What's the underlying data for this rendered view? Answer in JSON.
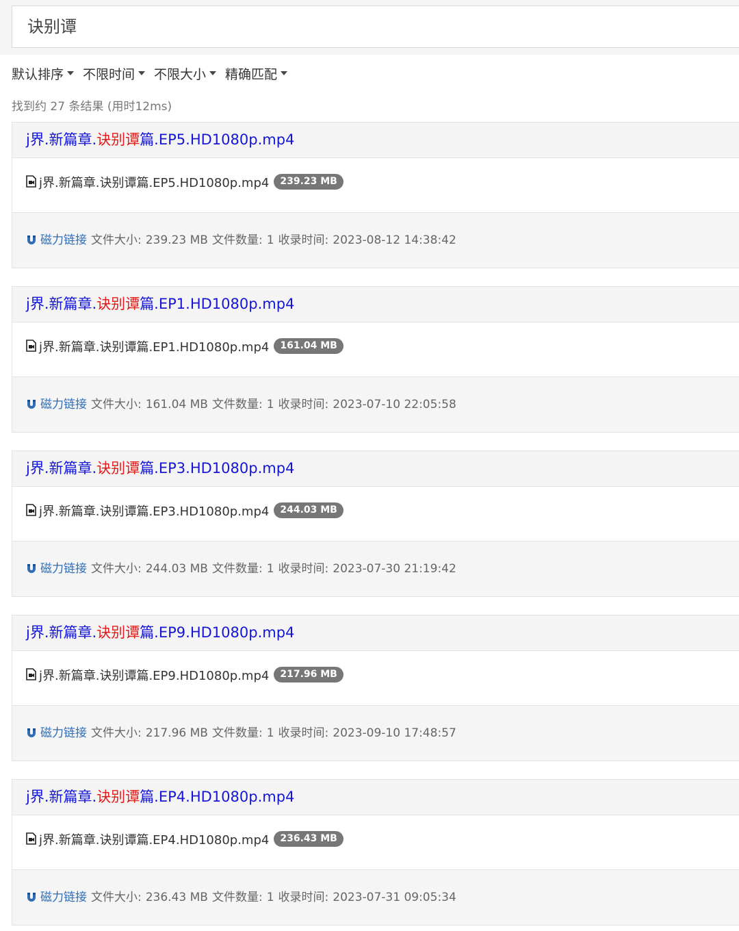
{
  "search": {
    "value": "诀别谭"
  },
  "filters": [
    {
      "label": "默认排序"
    },
    {
      "label": "不限时间"
    },
    {
      "label": "不限大小"
    },
    {
      "label": "精确匹配"
    }
  ],
  "summary": "找到约 27 条结果 (用时12ms)",
  "labels": {
    "magnet": "磁力链接",
    "size_prefix": "文件大小:",
    "count_prefix": "文件数量:",
    "time_prefix": "收录时间:"
  },
  "results": [
    {
      "title_pre": "j界.新篇章.",
      "title_hl": "诀别谭",
      "title_post": "篇.EP5.HD1080p.mp4",
      "file": "j界.新篇章.诀别谭篇.EP5.HD1080p.mp4",
      "size": "239.23 MB",
      "count": "1",
      "time": "2023-08-12 14:38:42"
    },
    {
      "title_pre": "j界.新篇章.",
      "title_hl": "诀别谭",
      "title_post": "篇.EP1.HD1080p.mp4",
      "file": "j界.新篇章.诀别谭篇.EP1.HD1080p.mp4",
      "size": "161.04 MB",
      "count": "1",
      "time": "2023-07-10 22:05:58"
    },
    {
      "title_pre": "j界.新篇章.",
      "title_hl": "诀别谭",
      "title_post": "篇.EP3.HD1080p.mp4",
      "file": "j界.新篇章.诀别谭篇.EP3.HD1080p.mp4",
      "size": "244.03 MB",
      "count": "1",
      "time": "2023-07-30 21:19:42"
    },
    {
      "title_pre": "j界.新篇章.",
      "title_hl": "诀别谭",
      "title_post": "篇.EP9.HD1080p.mp4",
      "file": "j界.新篇章.诀别谭篇.EP9.HD1080p.mp4",
      "size": "217.96 MB",
      "count": "1",
      "time": "2023-09-10 17:48:57"
    },
    {
      "title_pre": "j界.新篇章.",
      "title_hl": "诀别谭",
      "title_post": "篇.EP4.HD1080p.mp4",
      "file": "j界.新篇章.诀别谭篇.EP4.HD1080p.mp4",
      "size": "236.43 MB",
      "count": "1",
      "time": "2023-07-31 09:05:34"
    }
  ],
  "colors": {
    "title_link": "#1515d6",
    "highlight": "#e21b1b",
    "magnet_link": "#2f6db5",
    "badge": "#777777"
  },
  "icons": {
    "file": "video-file-icon",
    "magnet": "magnet-icon",
    "dropdown": "caret-down-icon"
  }
}
